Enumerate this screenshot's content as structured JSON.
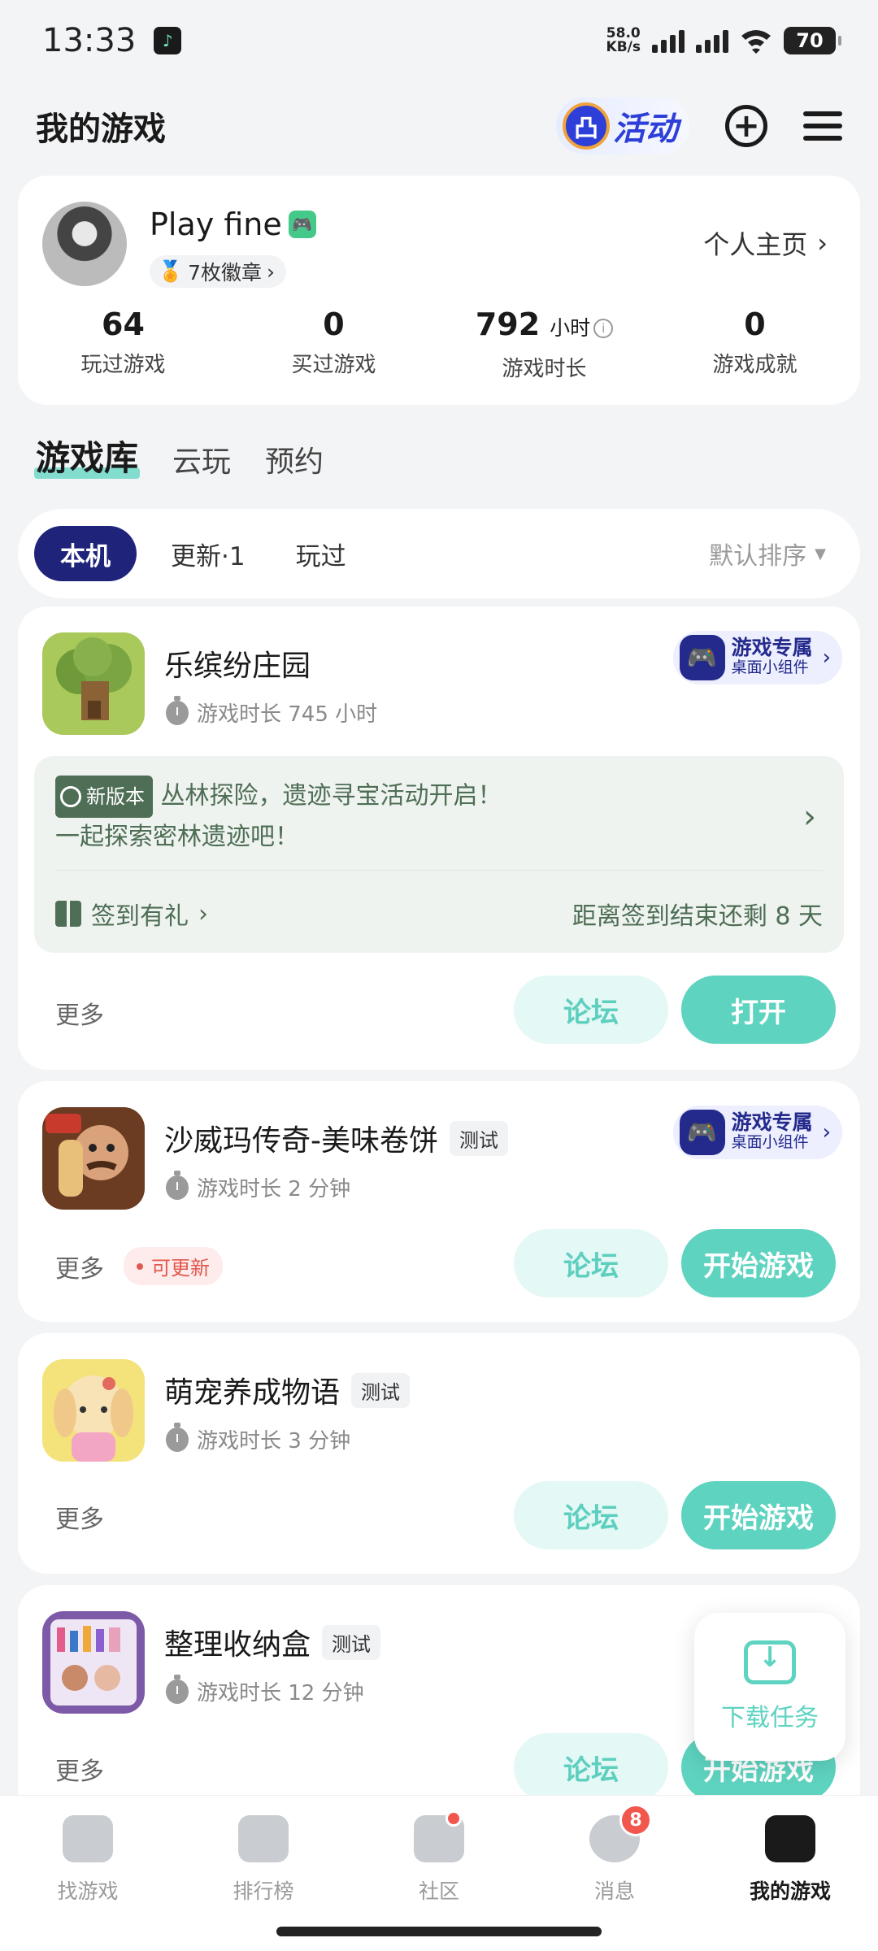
{
  "status": {
    "time": "13:33",
    "net_speed_top": "58.0",
    "net_speed_bottom": "KB/s",
    "battery": "70"
  },
  "header": {
    "title": "我的游戏",
    "activity_label": "活动"
  },
  "profile": {
    "name": "Play fine",
    "medals": "7枚徽章",
    "homepage_link": "个人主页",
    "stats": [
      {
        "value": "64",
        "unit": "",
        "label": "玩过游戏"
      },
      {
        "value": "0",
        "unit": "",
        "label": "买过游戏"
      },
      {
        "value": "792",
        "unit": "小时",
        "label": "游戏时长"
      },
      {
        "value": "0",
        "unit": "",
        "label": "游戏成就"
      }
    ]
  },
  "library_tabs": [
    "游戏库",
    "云玩",
    "预约"
  ],
  "filters": {
    "chips": [
      "本机",
      "更新·1",
      "玩过"
    ],
    "sort": "默认排序"
  },
  "widget": {
    "title": "游戏专属",
    "sub": "桌面小组件"
  },
  "games": [
    {
      "title": "乐缤纷庄园",
      "tag": "",
      "playtime": "游戏时长 745 小时",
      "more": "更多",
      "forum": "论坛",
      "action": "打开",
      "promo": {
        "tag": "新版本",
        "line1": "丛林探险，遗迹寻宝活动开启！",
        "line2": "一起探索密林遗迹吧！",
        "checkin": "签到有礼",
        "remaining": "距离签到结束还剩 8 天"
      }
    },
    {
      "title": "沙威玛传奇-美味卷饼",
      "tag": "测试",
      "playtime": "游戏时长 2 分钟",
      "more": "更多",
      "update": "可更新",
      "forum": "论坛",
      "action": "开始游戏"
    },
    {
      "title": "萌宠养成物语",
      "tag": "测试",
      "playtime": "游戏时长 3 分钟",
      "more": "更多",
      "forum": "论坛",
      "action": "开始游戏"
    },
    {
      "title": "整理收纳盒",
      "tag": "测试",
      "playtime": "游戏时长 12 分钟",
      "more": "更多",
      "forum": "论坛",
      "action": "开始游戏"
    }
  ],
  "download": {
    "label": "下载任务"
  },
  "bottom_nav": [
    {
      "label": "找游戏",
      "icon": "find-game-icon"
    },
    {
      "label": "排行榜",
      "icon": "leaderboard-icon"
    },
    {
      "label": "社区",
      "icon": "community-icon"
    },
    {
      "label": "消息",
      "icon": "message-icon",
      "badge": "8"
    },
    {
      "label": "我的游戏",
      "icon": "my-games-icon"
    }
  ]
}
